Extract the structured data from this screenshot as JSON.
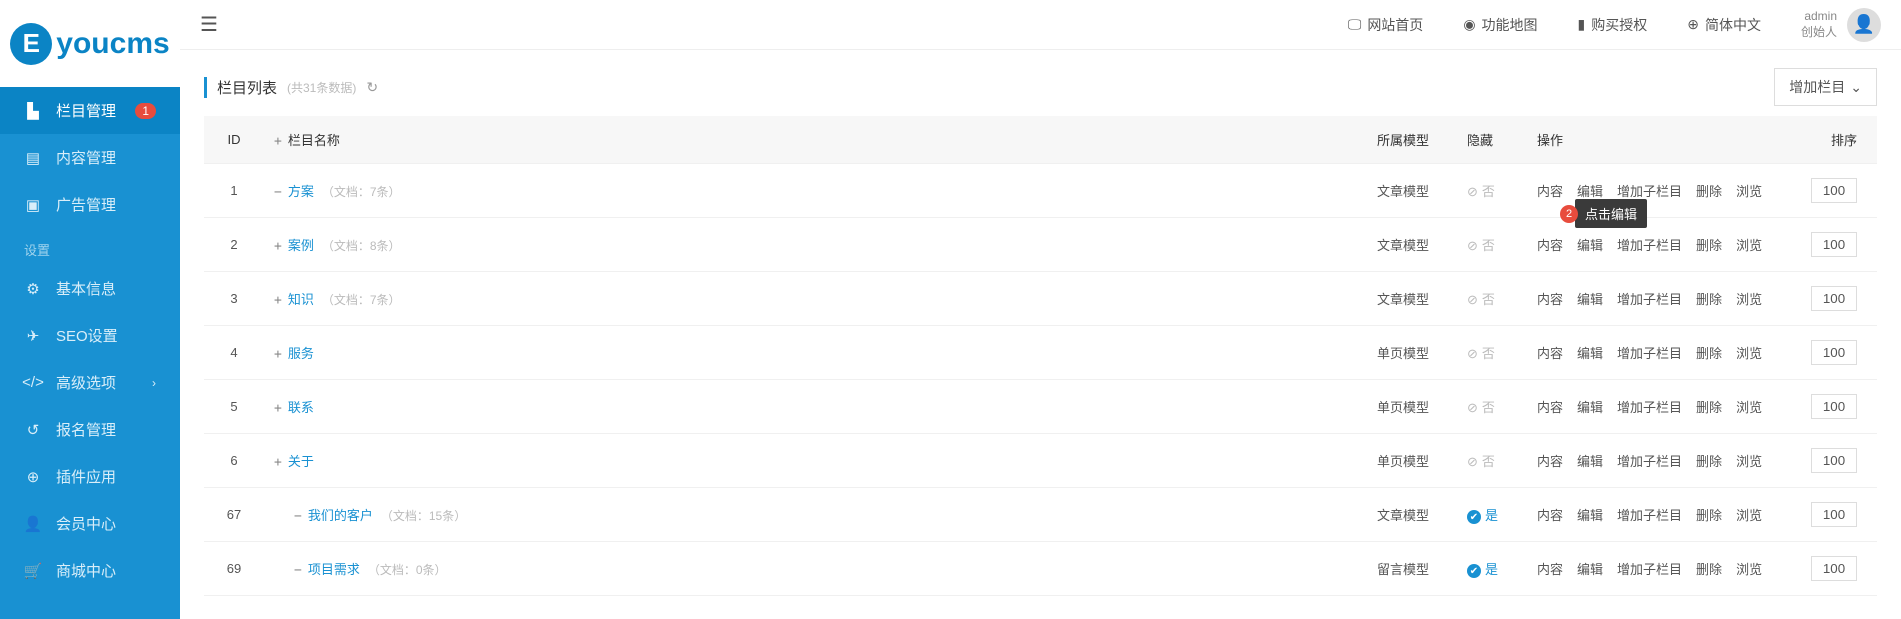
{
  "logo_text": "youcms",
  "topbar": {
    "site_home": "网站首页",
    "feature_map": "功能地图",
    "buy_license": "购买授权",
    "language": "简体中文",
    "user_name": "admin",
    "user_role": "创始人"
  },
  "sidebar": {
    "items": [
      {
        "label": "栏目管理",
        "badge": "1",
        "active": true,
        "icon": "sitemap"
      },
      {
        "label": "内容管理",
        "icon": "list"
      },
      {
        "label": "广告管理",
        "icon": "image"
      }
    ],
    "section_title": "设置",
    "settings": [
      {
        "label": "基本信息",
        "icon": "gear"
      },
      {
        "label": "SEO设置",
        "icon": "plane"
      },
      {
        "label": "高级选项",
        "icon": "code",
        "chevron": true
      },
      {
        "label": "报名管理",
        "icon": "undo"
      },
      {
        "label": "插件应用",
        "icon": "globe"
      },
      {
        "label": "会员中心",
        "icon": "user"
      },
      {
        "label": "商城中心",
        "icon": "cart"
      }
    ]
  },
  "content": {
    "title": "栏目列表",
    "subtitle": "(共31条数据)",
    "add_button": "增加栏目"
  },
  "table": {
    "headers": {
      "id": "ID",
      "name_prefix": "+",
      "name": "栏目名称",
      "model": "所属模型",
      "hidden": "隐藏",
      "ops": "操作",
      "sort": "排序"
    },
    "ops_labels": {
      "content": "内容",
      "edit": "编辑",
      "add_sub": "增加子栏目",
      "delete": "删除",
      "preview": "浏览"
    },
    "rows": [
      {
        "id": "1",
        "sign": "−",
        "name": "方案",
        "docs": "（文档：7条）",
        "model": "文章模型",
        "hidden": "否",
        "hidden_yes": false,
        "sort": "100",
        "indent": false
      },
      {
        "id": "2",
        "sign": "+",
        "name": "案例",
        "docs": "（文档：8条）",
        "model": "文章模型",
        "hidden": "否",
        "hidden_yes": false,
        "sort": "100",
        "indent": false
      },
      {
        "id": "3",
        "sign": "+",
        "name": "知识",
        "docs": "（文档：7条）",
        "model": "文章模型",
        "hidden": "否",
        "hidden_yes": false,
        "sort": "100",
        "indent": false
      },
      {
        "id": "4",
        "sign": "+",
        "name": "服务",
        "docs": "",
        "model": "单页模型",
        "hidden": "否",
        "hidden_yes": false,
        "sort": "100",
        "indent": false
      },
      {
        "id": "5",
        "sign": "+",
        "name": "联系",
        "docs": "",
        "model": "单页模型",
        "hidden": "否",
        "hidden_yes": false,
        "sort": "100",
        "indent": false
      },
      {
        "id": "6",
        "sign": "+",
        "name": "关于",
        "docs": "",
        "model": "单页模型",
        "hidden": "否",
        "hidden_yes": false,
        "sort": "100",
        "indent": false
      },
      {
        "id": "67",
        "sign": "−",
        "name": "我们的客户",
        "docs": "（文档：15条）",
        "model": "文章模型",
        "hidden": "是",
        "hidden_yes": true,
        "sort": "100",
        "indent": true
      },
      {
        "id": "69",
        "sign": "−",
        "name": "项目需求",
        "docs": "（文档：0条）",
        "model": "留言模型",
        "hidden": "是",
        "hidden_yes": true,
        "sort": "100",
        "indent": true
      }
    ]
  },
  "tooltip": {
    "badge": "2",
    "text": "点击编辑"
  },
  "icons": {
    "sitemap": "▙",
    "list": "▤",
    "image": "▣",
    "gear": "⚙",
    "plane": "✈",
    "code": "</>",
    "undo": "↺",
    "globe": "⊕",
    "user": "👤",
    "cart": "🛒",
    "monitor": "🖵",
    "eye": "◉",
    "bookmark": "▮",
    "lang": "⊕",
    "hamburger": "☰",
    "refresh": "↻",
    "chevron_down": "⌄",
    "chevron_right": "›"
  }
}
